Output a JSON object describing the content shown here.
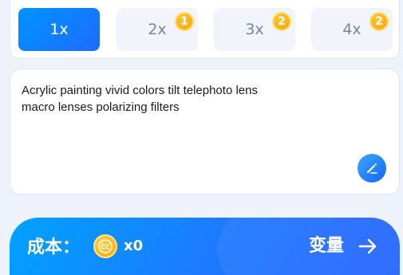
{
  "multipliers": [
    {
      "label": "1x",
      "badge": ""
    },
    {
      "label": "2x",
      "badge": "1"
    },
    {
      "label": "3x",
      "badge": "2"
    },
    {
      "label": "4x",
      "badge": "2"
    }
  ],
  "active_multiplier": "1x",
  "prompt": {
    "text": "Acrylic painting  vivid colors  tilt  telephoto lens\nmacro lenses  polarizing filters"
  },
  "action_bar": {
    "cost_label": "成本：",
    "coin_glyph": "CC",
    "cost_value": "x0",
    "submit_label": "变量"
  },
  "colors": {
    "accent": "#1f6bff",
    "badge": "#ff9d00",
    "background": "#eef3fb"
  }
}
